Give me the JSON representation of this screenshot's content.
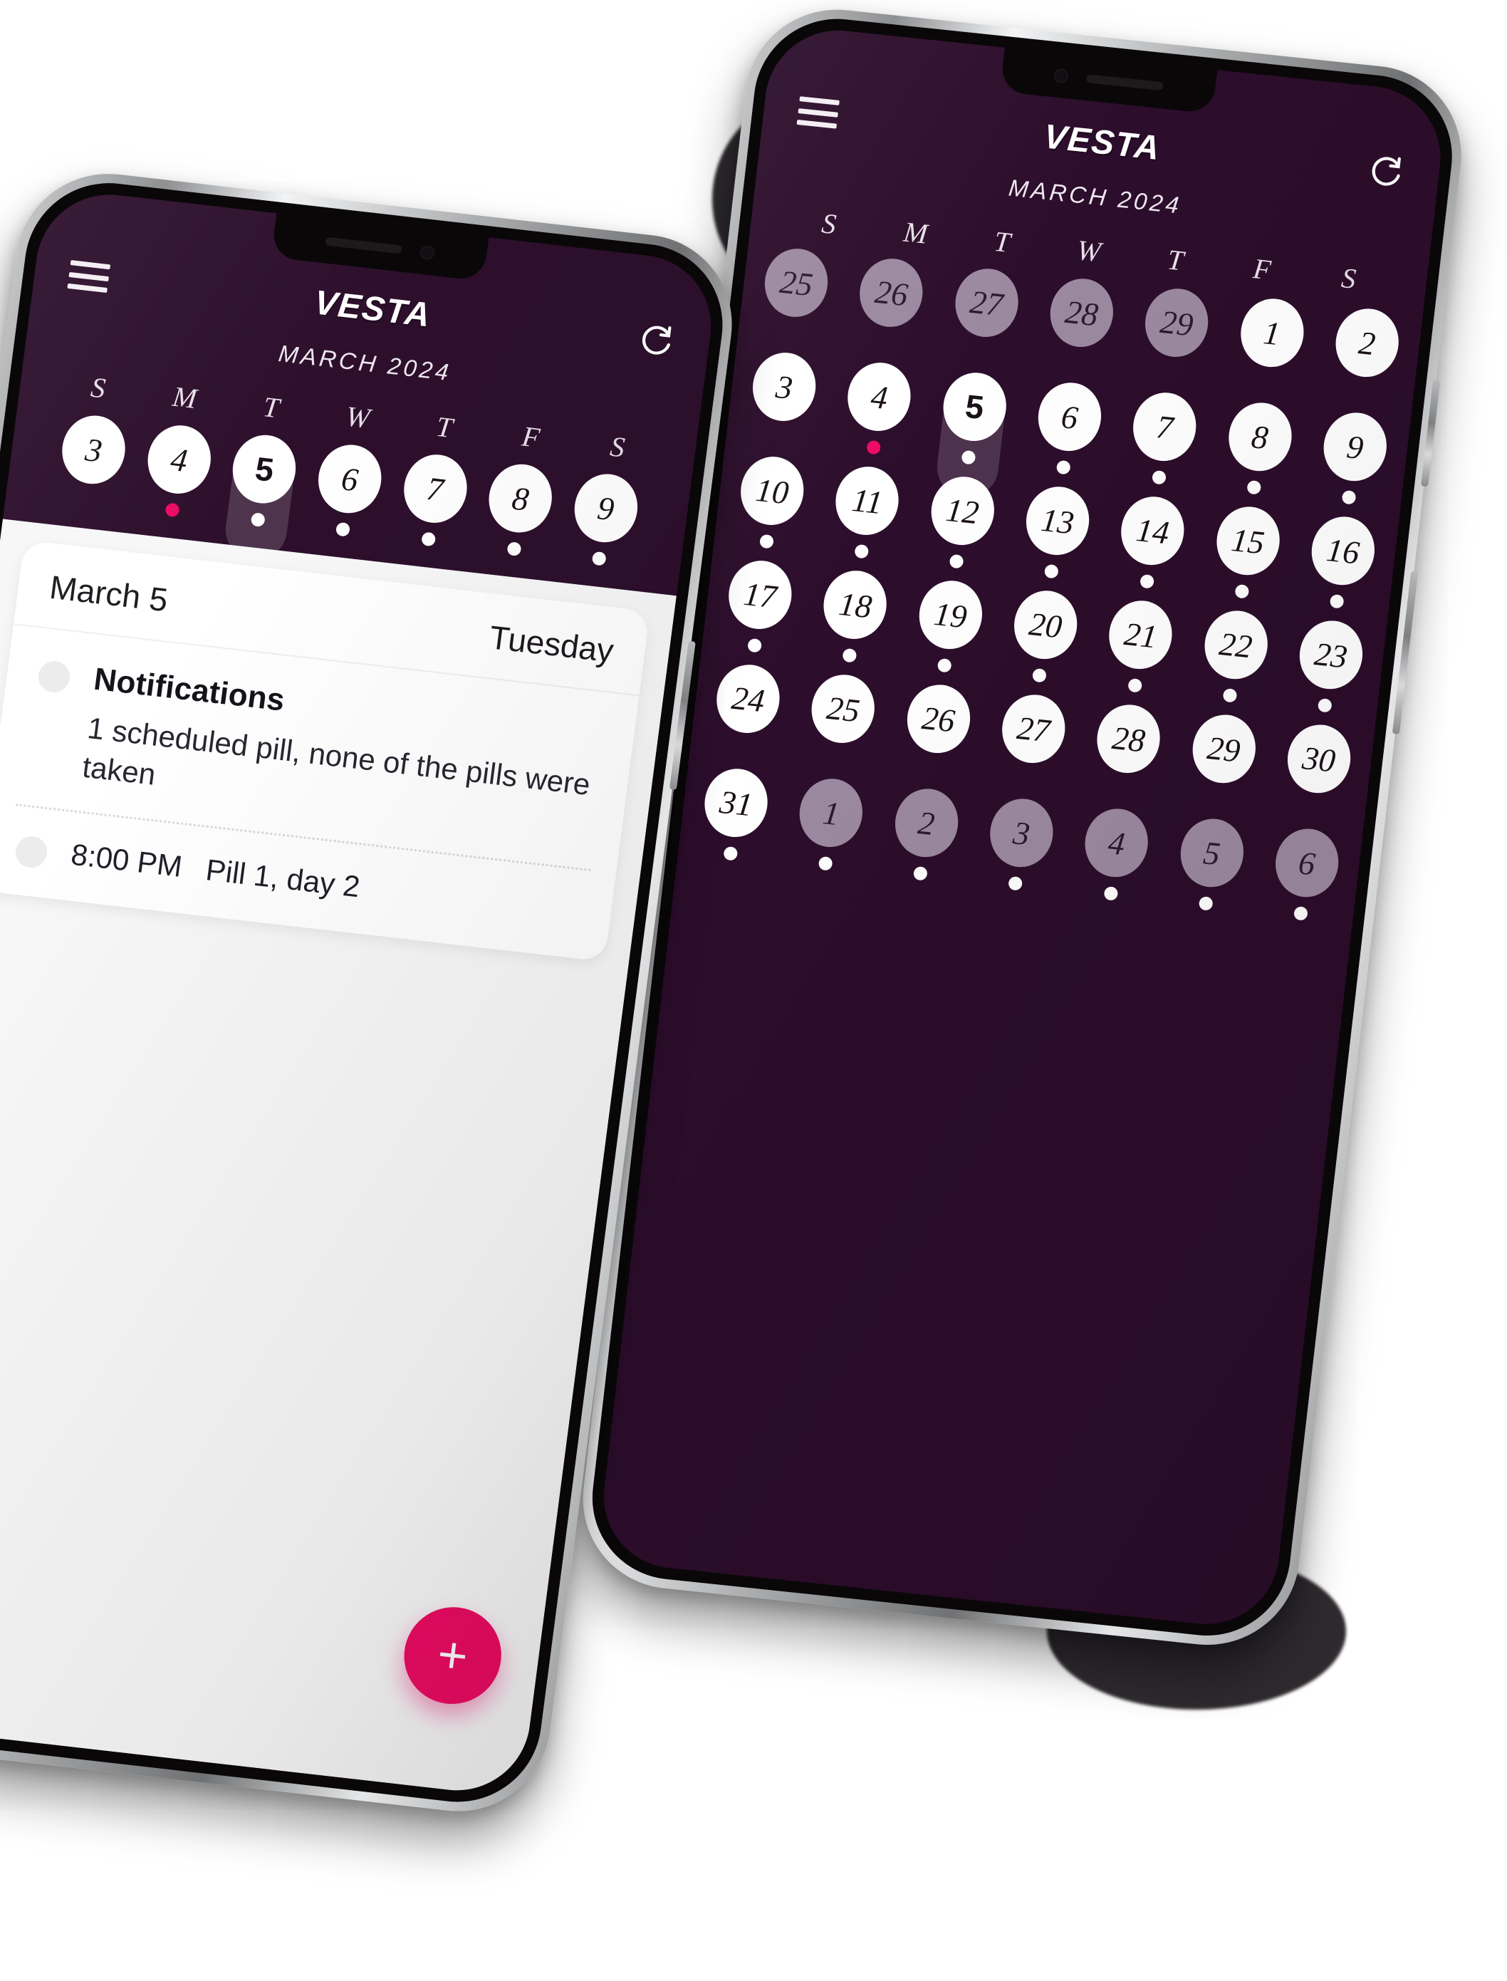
{
  "app": {
    "brand": "VESTA",
    "month_label": "MARCH 2024",
    "menu_icon": "hamburger-icon",
    "refresh_icon": "refresh-icon",
    "accent_color": "#ed0b63",
    "background_color": "#2c0d2b"
  },
  "weekdays": [
    "S",
    "M",
    "T",
    "W",
    "T",
    "F",
    "S"
  ],
  "back_phone": {
    "calendar_days": [
      {
        "label": "25",
        "state": "other-month",
        "dot": "none"
      },
      {
        "label": "26",
        "state": "other-month",
        "dot": "none"
      },
      {
        "label": "27",
        "state": "other-month",
        "dot": "none"
      },
      {
        "label": "28",
        "state": "other-month",
        "dot": "none"
      },
      {
        "label": "29",
        "state": "other-month",
        "dot": "none"
      },
      {
        "label": "1",
        "state": "current-month",
        "dot": "none"
      },
      {
        "label": "2",
        "state": "current-month",
        "dot": "none"
      },
      {
        "label": "3",
        "state": "current-month",
        "dot": "none"
      },
      {
        "label": "4",
        "state": "current-month",
        "dot": "period"
      },
      {
        "label": "5",
        "state": "selected",
        "dot": "scheduled"
      },
      {
        "label": "6",
        "state": "current-month",
        "dot": "scheduled"
      },
      {
        "label": "7",
        "state": "current-month",
        "dot": "scheduled"
      },
      {
        "label": "8",
        "state": "current-month",
        "dot": "scheduled"
      },
      {
        "label": "9",
        "state": "current-month",
        "dot": "scheduled"
      },
      {
        "label": "10",
        "state": "current-month",
        "dot": "scheduled"
      },
      {
        "label": "11",
        "state": "current-month",
        "dot": "scheduled"
      },
      {
        "label": "12",
        "state": "current-month",
        "dot": "scheduled"
      },
      {
        "label": "13",
        "state": "current-month",
        "dot": "scheduled"
      },
      {
        "label": "14",
        "state": "current-month",
        "dot": "scheduled"
      },
      {
        "label": "15",
        "state": "current-month",
        "dot": "scheduled"
      },
      {
        "label": "16",
        "state": "current-month",
        "dot": "scheduled"
      },
      {
        "label": "17",
        "state": "current-month",
        "dot": "scheduled"
      },
      {
        "label": "18",
        "state": "current-month",
        "dot": "scheduled"
      },
      {
        "label": "19",
        "state": "current-month",
        "dot": "scheduled"
      },
      {
        "label": "20",
        "state": "current-month",
        "dot": "scheduled"
      },
      {
        "label": "21",
        "state": "current-month",
        "dot": "scheduled"
      },
      {
        "label": "22",
        "state": "current-month",
        "dot": "scheduled"
      },
      {
        "label": "23",
        "state": "current-month",
        "dot": "scheduled"
      },
      {
        "label": "24",
        "state": "current-month",
        "dot": "none"
      },
      {
        "label": "25",
        "state": "current-month",
        "dot": "none"
      },
      {
        "label": "26",
        "state": "current-month",
        "dot": "none"
      },
      {
        "label": "27",
        "state": "current-month",
        "dot": "none"
      },
      {
        "label": "28",
        "state": "current-month",
        "dot": "none"
      },
      {
        "label": "29",
        "state": "current-month",
        "dot": "none"
      },
      {
        "label": "30",
        "state": "current-month",
        "dot": "none"
      },
      {
        "label": "31",
        "state": "current-month",
        "dot": "scheduled"
      },
      {
        "label": "1",
        "state": "other-month",
        "dot": "scheduled"
      },
      {
        "label": "2",
        "state": "other-month",
        "dot": "scheduled"
      },
      {
        "label": "3",
        "state": "other-month",
        "dot": "scheduled"
      },
      {
        "label": "4",
        "state": "other-month",
        "dot": "scheduled"
      },
      {
        "label": "5",
        "state": "other-month",
        "dot": "scheduled"
      },
      {
        "label": "6",
        "state": "other-month",
        "dot": "scheduled"
      }
    ]
  },
  "front_phone": {
    "week_days": [
      {
        "label": "3",
        "state": "current-month",
        "dot": "none"
      },
      {
        "label": "4",
        "state": "current-month",
        "dot": "period"
      },
      {
        "label": "5",
        "state": "selected",
        "dot": "scheduled"
      },
      {
        "label": "6",
        "state": "current-month",
        "dot": "scheduled"
      },
      {
        "label": "7",
        "state": "current-month",
        "dot": "scheduled"
      },
      {
        "label": "8",
        "state": "current-month",
        "dot": "scheduled"
      },
      {
        "label": "9",
        "state": "current-month",
        "dot": "scheduled"
      }
    ],
    "detail": {
      "date": "March 5",
      "day_of_week": "Tuesday",
      "section_title": "Notifications",
      "summary": "1 scheduled pill, none of the pills were taken",
      "event_time": "8:00 PM",
      "event_text": "Pill 1, day 2"
    },
    "add_button_label": "+"
  }
}
